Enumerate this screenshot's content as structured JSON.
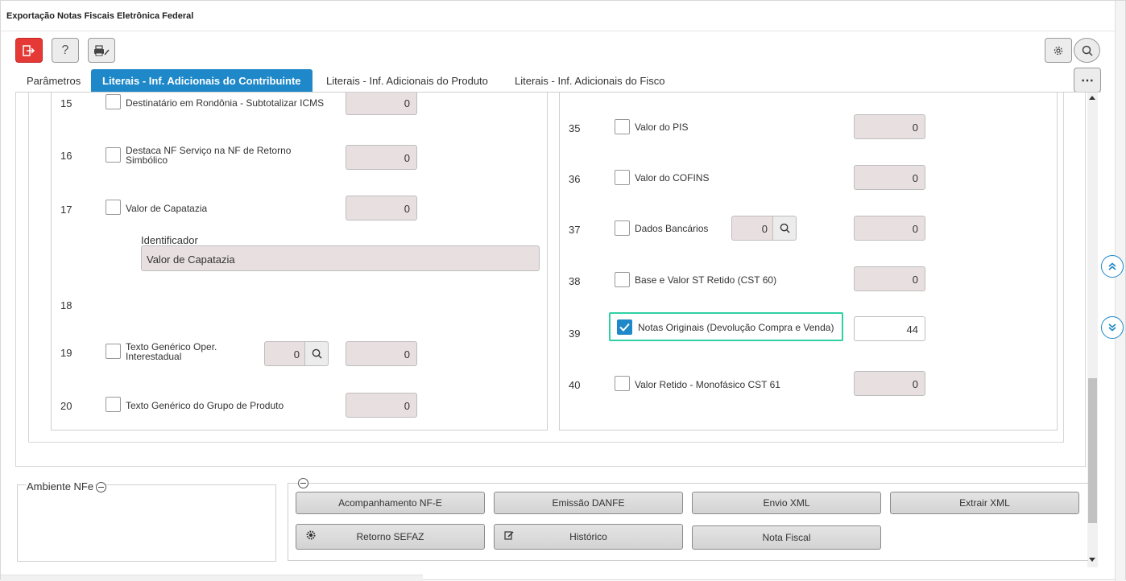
{
  "window": {
    "title": "Exportação Notas Fiscais Eletrônica Federal"
  },
  "toolbar": {
    "exit_icon": "exit-icon",
    "help_label": "?",
    "print_icon": "printer-edit-icon",
    "gear_icon": "gear-icon",
    "search_icon": "search-icon",
    "more_label": "⋯"
  },
  "tabs": [
    {
      "label": "Parâmetros",
      "active": false
    },
    {
      "label": "Literais - Inf. Adicionais do Contribuinte",
      "active": true
    },
    {
      "label": "Literais - Inf. Adicionais do Produto",
      "active": false
    },
    {
      "label": "Literais - Inf. Adicionais do Fisco",
      "active": false
    }
  ],
  "left_rows": [
    {
      "num": "15",
      "label": "Destinatário em Rondônia - Subtotalizar ICMS",
      "value": "0",
      "checked": false
    },
    {
      "num": "16",
      "label1": "Destaca NF Serviço na NF de Retorno",
      "label2": "Simbólico",
      "value": "0",
      "checked": false
    },
    {
      "num": "17",
      "label": "Valor de Capatazia",
      "value": "0",
      "checked": false,
      "identifier_label": "Identificador",
      "identifier_value": "Valor de Capatazia"
    },
    {
      "num": "18"
    },
    {
      "num": "19",
      "label1": "Texto Genérico Oper.",
      "label2": "Interestadual",
      "lookup_value": "0",
      "value": "0",
      "checked": false
    },
    {
      "num": "20",
      "label": "Texto Genérico do Grupo de Produto",
      "value": "0",
      "checked": false
    }
  ],
  "right_rows": [
    {
      "num": "35",
      "label": "Valor do PIS",
      "value": "0",
      "checked": false
    },
    {
      "num": "36",
      "label": "Valor do COFINS",
      "value": "0",
      "checked": false
    },
    {
      "num": "37",
      "label": "Dados Bancários",
      "lookup_value": "0",
      "value": "0",
      "checked": false
    },
    {
      "num": "38",
      "label": "Base e Valor ST Retido (CST 60)",
      "value": "0",
      "checked": false
    },
    {
      "num": "39",
      "label": "Notas Originais (Devolução Compra e Venda)",
      "value": "44",
      "checked": true
    },
    {
      "num": "40",
      "label": "Valor Retido - Monofásico CST 61",
      "value": "0",
      "checked": false
    }
  ],
  "ambiente": {
    "title": "Ambiente NFe"
  },
  "actions": {
    "acompanhamento": "Acompanhamento NF-E",
    "emissao": "Emissão DANFE",
    "envio": "Envio XML",
    "extrair": "Extrair XML",
    "retorno": "Retorno SEFAZ",
    "historico": "Histórico",
    "nota": "Nota Fiscal"
  },
  "colors": {
    "accent": "#1e88c9",
    "exit": "#e53935",
    "highlight": "#2fd1a4",
    "readonly_bg": "#e8e0e0"
  }
}
